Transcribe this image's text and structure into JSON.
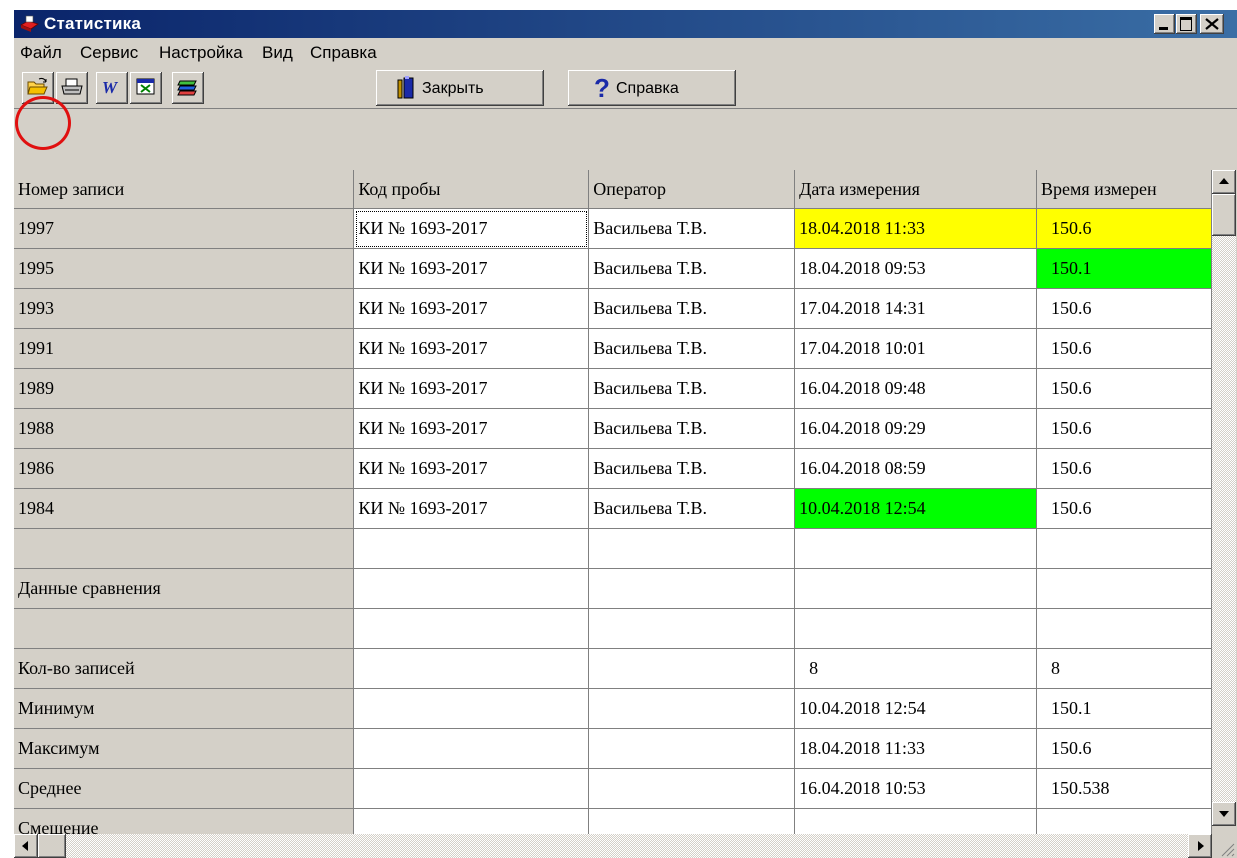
{
  "window": {
    "title": "Статистика"
  },
  "menu": [
    "Файл",
    "Сервис",
    "Настройка",
    "Вид",
    "Справка"
  ],
  "toolbar": {
    "close_label": "Закрыть",
    "help_label": "Справка"
  },
  "table": {
    "columns": [
      "Номер записи",
      "Код пробы",
      "Оператор",
      "Дата измерения",
      "Время измерен"
    ],
    "rows": [
      [
        "1997",
        "КИ № 1693-2017",
        "Васильева Т.В.",
        "18.04.2018 11:33",
        "150.6"
      ],
      [
        "1995",
        "КИ № 1693-2017",
        "Васильева Т.В.",
        "18.04.2018 09:53",
        "150.1"
      ],
      [
        "1993",
        "КИ № 1693-2017",
        "Васильева Т.В.",
        "17.04.2018 14:31",
        "150.6"
      ],
      [
        "1991",
        "КИ № 1693-2017",
        "Васильева Т.В.",
        "17.04.2018 10:01",
        "150.6"
      ],
      [
        "1989",
        "КИ № 1693-2017",
        "Васильева Т.В.",
        "16.04.2018 09:48",
        "150.6"
      ],
      [
        "1988",
        "КИ № 1693-2017",
        "Васильева Т.В.",
        "16.04.2018 09:29",
        "150.6"
      ],
      [
        "1986",
        "КИ № 1693-2017",
        "Васильева Т.В.",
        "16.04.2018 08:59",
        "150.6"
      ],
      [
        "1984",
        "КИ № 1693-2017",
        "Васильева Т.В.",
        "10.04.2018 12:54",
        "150.6"
      ]
    ],
    "comparison_label": "Данные сравнения",
    "stats": [
      {
        "label": "Кол-во записей",
        "date": "8",
        "value": "8"
      },
      {
        "label": "Минимум",
        "date": "10.04.2018 12:54",
        "value": "150.1"
      },
      {
        "label": "Максимум",
        "date": "18.04.2018 11:33",
        "value": "150.6"
      },
      {
        "label": "Среднее",
        "date": "16.04.2018 10:53",
        "value": "150.538"
      },
      {
        "label": "Смещение",
        "date": "",
        "value": ""
      }
    ]
  },
  "colors": {
    "highlight_yellow": "#ffff00",
    "highlight_green": "#00ff00",
    "annotation_red": "#e01010"
  }
}
